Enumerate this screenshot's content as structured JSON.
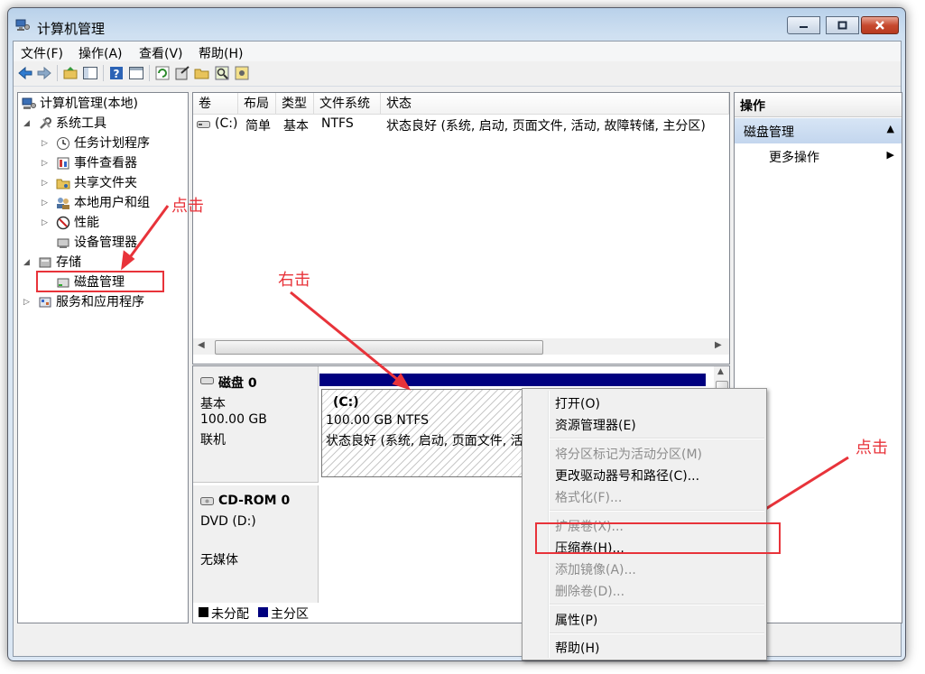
{
  "window": {
    "title": "计算机管理"
  },
  "menu": [
    "文件(F)",
    "操作(A)",
    "查看(V)",
    "帮助(H)"
  ],
  "tree": {
    "root": "计算机管理(本地)",
    "system_tools": "系统工具",
    "task_scheduler": "任务计划程序",
    "event_viewer": "事件查看器",
    "shared_folders": "共享文件夹",
    "local_users": "本地用户和组",
    "performance": "性能",
    "device_manager": "设备管理器",
    "storage": "存储",
    "disk_management": "磁盘管理",
    "services_apps": "服务和应用程序"
  },
  "volume_list": {
    "headers": [
      "卷",
      "布局",
      "类型",
      "文件系统",
      "状态"
    ],
    "rows": [
      {
        "volume": "(C:)",
        "layout": "简单",
        "type": "基本",
        "fs": "NTFS",
        "status": "状态良好 (系统, 启动, 页面文件, 活动, 故障转储, 主分区)"
      }
    ]
  },
  "disks": [
    {
      "name": "磁盘 0",
      "kind": "基本",
      "size": "100.00 GB",
      "state": "联机",
      "partition": {
        "label": "(C:)",
        "size_fs": "100.00 GB NTFS",
        "status": "状态良好 (系统, 启动, 页面文件, 活"
      }
    },
    {
      "name": "CD-ROM 0",
      "kind": "DVD (D:)",
      "state": "无媒体"
    }
  ],
  "legend": {
    "unallocated": "未分配",
    "primary": "主分区"
  },
  "actions": {
    "header": "操作",
    "section": "磁盘管理",
    "more": "更多操作"
  },
  "context_menu": [
    {
      "label": "打开(O)",
      "enabled": true
    },
    {
      "label": "资源管理器(E)",
      "enabled": true
    },
    {
      "label": "将分区标记为活动分区(M)",
      "enabled": false
    },
    {
      "label": "更改驱动器号和路径(C)...",
      "enabled": true
    },
    {
      "label": "格式化(F)...",
      "enabled": false
    },
    {
      "label": "扩展卷(X)...",
      "enabled": false
    },
    {
      "label": "压缩卷(H)...",
      "enabled": true
    },
    {
      "label": "添加镜像(A)...",
      "enabled": false
    },
    {
      "label": "删除卷(D)...",
      "enabled": false
    },
    {
      "label": "属性(P)",
      "enabled": true
    },
    {
      "label": "帮助(H)",
      "enabled": true
    }
  ],
  "annotations": {
    "click1": "点击",
    "right_click": "右击",
    "click2": "点击"
  },
  "colors": {
    "annotation": "#e8333a",
    "primary_partition": "#00007f",
    "unallocated": "#000000",
    "accent_blue": "#3a6ea5"
  },
  "icons": [
    "back-icon",
    "forward-icon",
    "up-folder-icon",
    "show-tree-icon",
    "help-icon",
    "properties-icon",
    "refresh-icon",
    "export-icon",
    "folder-open-icon",
    "search-icon",
    "settings-icon"
  ]
}
